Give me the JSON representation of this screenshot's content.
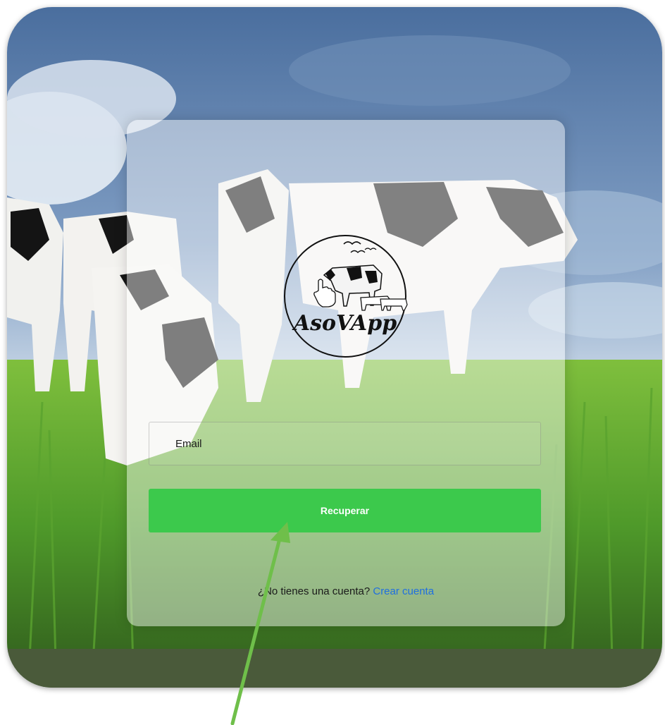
{
  "logo": {
    "text": "AsoVApp",
    "icon": "cow-with-hand-cursor-icon"
  },
  "form": {
    "email_placeholder": "Email",
    "recover_label": "Recuperar"
  },
  "signup": {
    "prompt": "¿No tienes una cuenta?",
    "link": "Crear cuenta"
  },
  "colors": {
    "button_green": "#3cc94c",
    "link_blue": "#1f6fe0",
    "annotation_arrow": "#6fbf4a"
  }
}
